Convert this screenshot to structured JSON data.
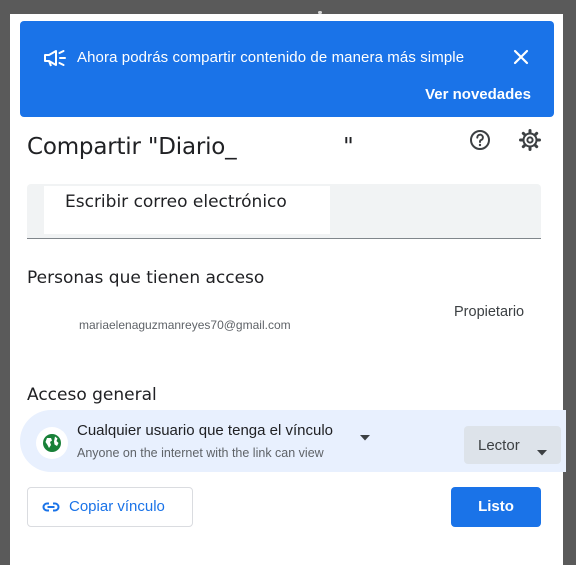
{
  "banner": {
    "text": "Ahora podrás compartir contenido de manera más simple",
    "link": "Ver novedades",
    "icon": "megaphone-icon",
    "color": "#1a73e8"
  },
  "dialog": {
    "title": "Compartir \"Diario_               \"",
    "help_icon": "help-icon",
    "settings_icon": "gear-icon"
  },
  "share_input": {
    "placeholder": "Escribir correo electrónico"
  },
  "people": {
    "heading": "Personas que tienen acceso",
    "items": [
      {
        "email": "mariaelenaguzmanreyes70@gmail.com",
        "role": "Propietario"
      }
    ]
  },
  "general_access": {
    "heading": "Acceso general",
    "option": "Cualquier usuario que tenga el vínculo",
    "description": "Anyone on the internet with the link can view",
    "role": "Lector",
    "icon": "globe-icon"
  },
  "footer": {
    "copy_link": "Copiar vínculo",
    "done": "Listo"
  }
}
